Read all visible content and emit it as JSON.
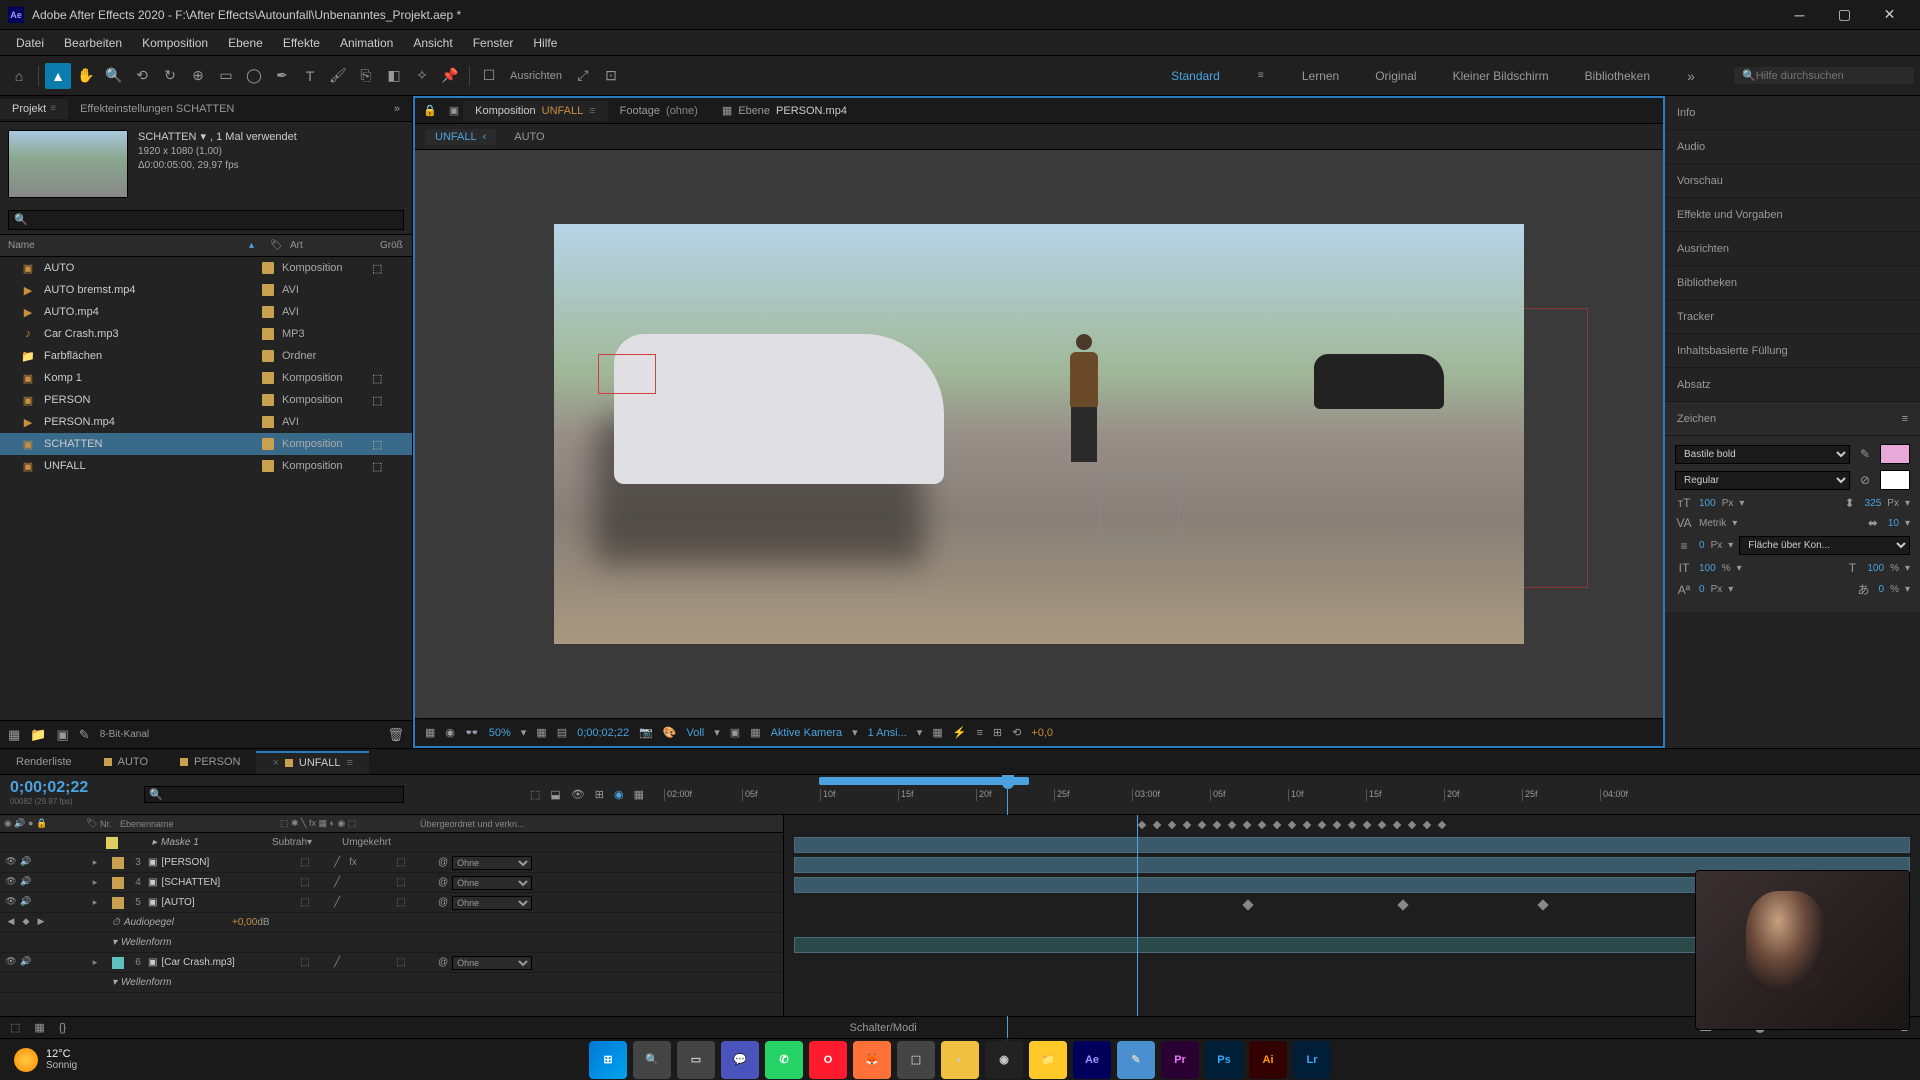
{
  "window": {
    "title": "Adobe After Effects 2020 - F:\\After Effects\\Autounfall\\Unbenanntes_Projekt.aep *"
  },
  "menu": [
    "Datei",
    "Bearbeiten",
    "Komposition",
    "Ebene",
    "Effekte",
    "Animation",
    "Ansicht",
    "Fenster",
    "Hilfe"
  ],
  "toolbar": {
    "align_label": "Ausrichten",
    "workspaces": [
      "Standard",
      "Lernen",
      "Original",
      "Kleiner Bildschirm",
      "Bibliotheken"
    ],
    "active_workspace": "Standard",
    "search_placeholder": "Hilfe durchsuchen"
  },
  "project": {
    "tab_project": "Projekt",
    "tab_effects": "Effekteinstellungen SCHATTEN",
    "selected": {
      "name": "SCHATTEN",
      "uses": ", 1 Mal verwendet",
      "dims": "1920 x 1080 (1,00)",
      "dur": "Δ0:00:05:00, 29,97 fps"
    },
    "cols": {
      "name": "Name",
      "type": "Art",
      "size": "Größ"
    },
    "items": [
      {
        "name": "AUTO",
        "type": "Komposition",
        "label": "#c8a050",
        "icon": "comp"
      },
      {
        "name": "AUTO bremst.mp4",
        "type": "AVI",
        "label": "#c8a050",
        "icon": "video"
      },
      {
        "name": "AUTO.mp4",
        "type": "AVI",
        "label": "#c8a050",
        "icon": "video"
      },
      {
        "name": "Car Crash.mp3",
        "type": "MP3",
        "label": "#c8a050",
        "icon": "audio"
      },
      {
        "name": "Farbflächen",
        "type": "Ordner",
        "label": "#c8a050",
        "icon": "folder"
      },
      {
        "name": "Komp 1",
        "type": "Komposition",
        "label": "#c8a050",
        "icon": "comp"
      },
      {
        "name": "PERSON",
        "type": "Komposition",
        "label": "#c8a050",
        "icon": "comp"
      },
      {
        "name": "PERSON.mp4",
        "type": "AVI",
        "label": "#c8a050",
        "icon": "video"
      },
      {
        "name": "SCHATTEN",
        "type": "Komposition",
        "label": "#c8a050",
        "icon": "comp",
        "selected": true
      },
      {
        "name": "UNFALL",
        "type": "Komposition",
        "label": "#c8a050",
        "icon": "comp"
      }
    ],
    "footer_label": "8-Bit-Kanal"
  },
  "comp": {
    "tabs": [
      {
        "label": "Komposition",
        "name": "UNFALL",
        "active": true
      },
      {
        "label": "Footage",
        "name": "(ohne)"
      },
      {
        "label": "Ebene",
        "name": "PERSON.mp4"
      }
    ],
    "flow": [
      "UNFALL",
      "AUTO"
    ],
    "footer": {
      "zoom": "50%",
      "timecode": "0;00;02;22",
      "res": "Voll",
      "camera": "Aktive Kamera",
      "views": "1 Ansi...",
      "exposure": "+0,0"
    }
  },
  "right_panels": [
    "Info",
    "Audio",
    "Vorschau",
    "Effekte und Vorgaben",
    "Ausrichten",
    "Bibliotheken",
    "Tracker",
    "Inhaltsbasierte Füllung",
    "Absatz",
    "Zeichen"
  ],
  "character": {
    "font": "Bastile bold",
    "style": "Regular",
    "size": "100",
    "size_unit": "Px",
    "leading": "325",
    "leading_unit": "Px",
    "kerning": "Metrik",
    "tracking": "10",
    "stroke": "0",
    "stroke_unit": "Px",
    "stroke_mode": "Fläche über Kon...",
    "vscale": "100",
    "vscale_unit": "%",
    "hscale": "100",
    "hscale_unit": "%",
    "baseline": "0",
    "baseline_unit": "Px",
    "tsume": "0",
    "tsume_unit": "%"
  },
  "timeline": {
    "tabs": [
      {
        "name": "Renderliste"
      },
      {
        "name": "AUTO"
      },
      {
        "name": "PERSON"
      },
      {
        "name": "UNFALL",
        "active": true
      }
    ],
    "timecode": "0;00;02;22",
    "frames": "00082 (29.97 fps)",
    "cols": {
      "num": "Nr.",
      "name": "Ebenenname",
      "parent": "Übergeordnet und verkn..."
    },
    "mask_mode": "Subtrah",
    "mask_invert": "Umgekehrt",
    "parent_none": "Ohne",
    "audio_level": "+0,00",
    "audio_unit": "dB",
    "layers": [
      {
        "sub": true,
        "name": "Maske 1",
        "label": "#e0d060"
      },
      {
        "num": "3",
        "name": "[PERSON]",
        "label": "#c8a050",
        "fx": true
      },
      {
        "num": "4",
        "name": "[SCHATTEN]",
        "label": "#c8a050"
      },
      {
        "num": "5",
        "name": "[AUTO]",
        "label": "#c8a050",
        "expanded": true
      },
      {
        "sub": true,
        "name": "Audiopegel",
        "prop": true
      },
      {
        "sub": true,
        "name": "Wellenform"
      },
      {
        "num": "6",
        "name": "[Car Crash.mp3]",
        "label": "#60c0c0"
      },
      {
        "sub": true,
        "name": "Wellenform"
      }
    ],
    "ruler": [
      "02:00f",
      "05f",
      "10f",
      "15f",
      "20f",
      "25f",
      "03:00f",
      "05f",
      "10f",
      "15f",
      "20f",
      "25f",
      "04:00f"
    ],
    "footer_mode": "Schalter/Modi"
  },
  "taskbar": {
    "temp": "12°C",
    "weather": "Sonnig"
  }
}
